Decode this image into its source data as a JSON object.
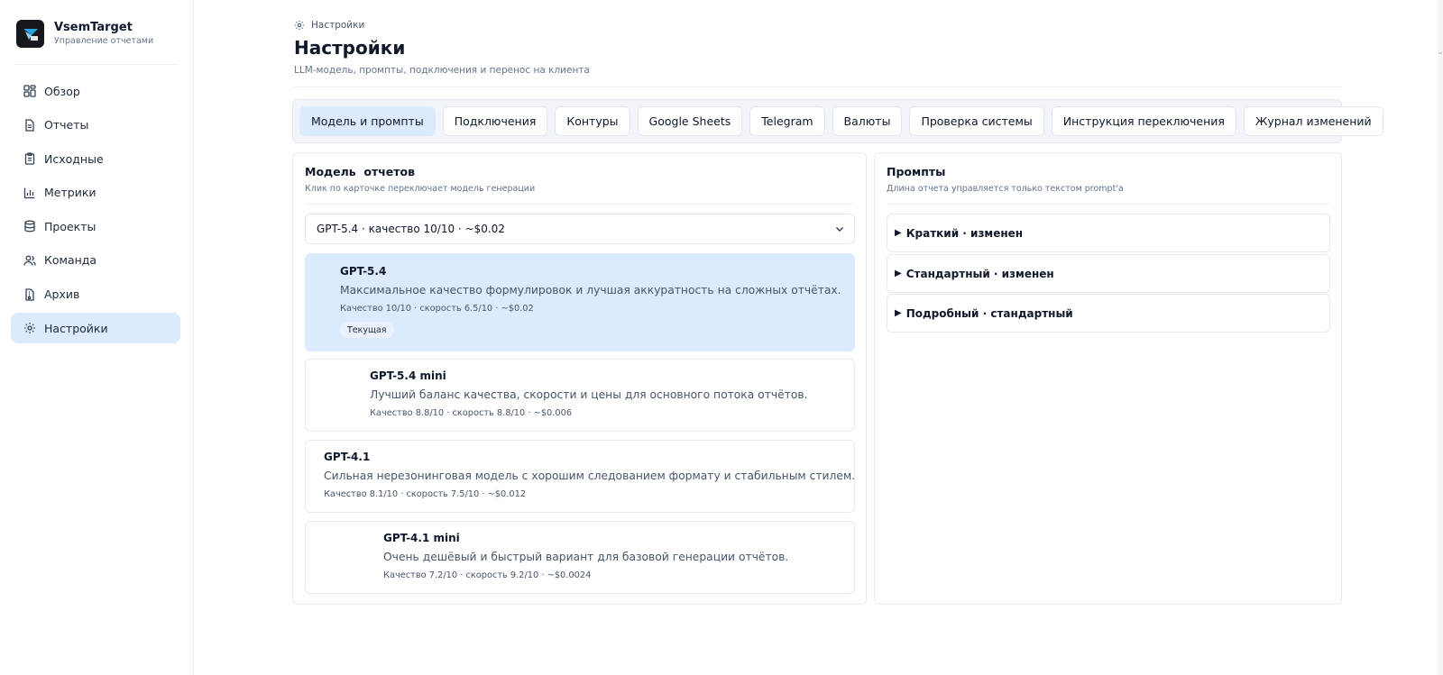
{
  "brand": {
    "name": "VsemTarget",
    "subtitle": "Управление отчетами"
  },
  "sidebar": {
    "items": [
      {
        "label": "Обзор",
        "icon": "dashboard-icon"
      },
      {
        "label": "Отчеты",
        "icon": "document-icon"
      },
      {
        "label": "Исходные",
        "icon": "clipboard-icon"
      },
      {
        "label": "Метрики",
        "icon": "bar-chart-icon"
      },
      {
        "label": "Проекты",
        "icon": "database-icon"
      },
      {
        "label": "Команда",
        "icon": "users-icon"
      },
      {
        "label": "Архив",
        "icon": "archive-file-icon"
      },
      {
        "label": "Настройки",
        "icon": "gear-icon",
        "active": true
      }
    ]
  },
  "header": {
    "breadcrumb": "Настройки",
    "title": "Настройки",
    "subtitle": "LLM-модель, промпты, подключения и перенос на клиента"
  },
  "tabs": [
    {
      "label": "Модель и промпты",
      "active": true
    },
    {
      "label": "Подключения"
    },
    {
      "label": "Контуры"
    },
    {
      "label": "Google Sheets"
    },
    {
      "label": "Telegram"
    },
    {
      "label": "Валюты"
    },
    {
      "label": "Проверка системы"
    },
    {
      "label": "Инструкция переключения"
    },
    {
      "label": "Журнал изменений"
    }
  ],
  "models_panel": {
    "title": "Модель  отчетов",
    "subtitle": "Клик по карточке переключает модель генерации",
    "select_value": "GPT-5.4 · качество 10/10 · ~$0.02",
    "cards": [
      {
        "name": "GPT-5.4",
        "desc": "Максимальное качество формулировок и лучшая аккуратность на сложных отчётах.",
        "meta": "Качество 10/10 · скорость 6.5/10 · ~$0.02",
        "badge": "Текущая",
        "selected": true
      },
      {
        "name": "GPT-5.4 mini",
        "desc": "Лучший баланс качества, скорости и цены для основного потока отчётов.",
        "meta": "Качество 8.8/10 · скорость 8.8/10 · ~$0.006"
      },
      {
        "name": "GPT-4.1",
        "desc": "Сильная нерезонинговая модель с хорошим следованием формату и стабильным стилем.",
        "meta": "Качество 8.1/10 · скорость 7.5/10 · ~$0.012"
      },
      {
        "name": "GPT-4.1 mini",
        "desc": "Очень дешёвый и быстрый вариант для базовой генерации отчётов.",
        "meta": "Качество 7.2/10 · скорость 9.2/10 · ~$0.0024"
      }
    ]
  },
  "prompts_panel": {
    "title": "Промпты",
    "subtitle": "Длина отчета управляется только текстом prompt'а",
    "items": [
      {
        "label": "Краткий · изменен"
      },
      {
        "label": "Стандартный · изменен"
      },
      {
        "label": "Подробный · стандартный"
      }
    ]
  },
  "colors": {
    "accent_bg": "#dbeafe",
    "text": "#0f172a",
    "muted": "#64748b"
  }
}
